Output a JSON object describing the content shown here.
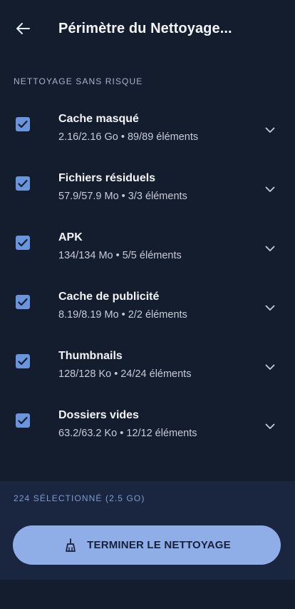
{
  "header": {
    "title": "Périmètre du Nettoyage...",
    "back_icon": "arrow-left-icon"
  },
  "section": {
    "label": "NETTOYAGE SANS RISQUE"
  },
  "items": [
    {
      "title": "Cache masqué",
      "subtitle": "2.16/2.16 Go • 89/89 éléments",
      "checked": true
    },
    {
      "title": "Fichiers résiduels",
      "subtitle": "57.9/57.9 Mo • 3/3 éléments",
      "checked": true
    },
    {
      "title": "APK",
      "subtitle": "134/134 Mo • 5/5 éléments",
      "checked": true
    },
    {
      "title": "Cache de publicité",
      "subtitle": "8.19/8.19 Mo • 2/2 éléments",
      "checked": true
    },
    {
      "title": "Thumbnails",
      "subtitle": "128/128 Ko • 24/24 éléments",
      "checked": true
    },
    {
      "title": "Dossiers vides",
      "subtitle": "63.2/63.2 Ko • 12/12 éléments",
      "checked": true
    }
  ],
  "footer": {
    "selected_label": "224 SÉLECTIONNÉ (2.5 GO)",
    "button_label": "TERMINER LE NETTOYAGE",
    "button_icon": "broom-icon"
  },
  "colors": {
    "background": "#141d2e",
    "panel": "#1a2540",
    "accent": "#8faee8",
    "checkbox": "#6a95dc"
  }
}
